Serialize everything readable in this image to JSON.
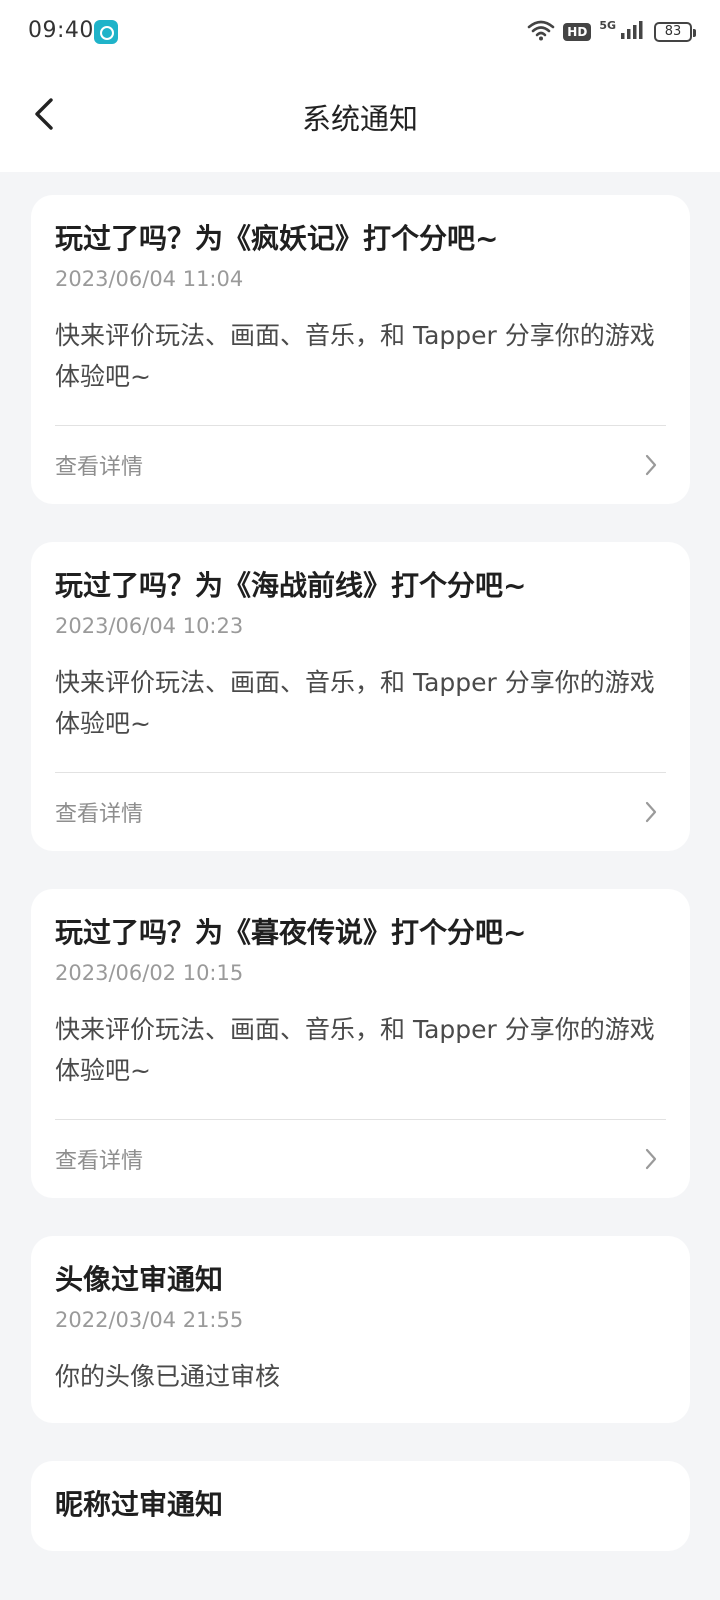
{
  "status_bar": {
    "time": "09:40",
    "hd": "HD",
    "network": "5G",
    "battery": "83"
  },
  "nav": {
    "title": "系统通知"
  },
  "notifications": [
    {
      "title": "玩过了吗？为《疯妖记》打个分吧~",
      "time": "2023/06/04 11:04",
      "body": "快来评价玩法、画面、音乐，和 Tapper 分享你的游戏体验吧~",
      "footer": "查看详情"
    },
    {
      "title": "玩过了吗？为《海战前线》打个分吧~",
      "time": "2023/06/04 10:23",
      "body": "快来评价玩法、画面、音乐，和 Tapper 分享你的游戏体验吧~",
      "footer": "查看详情"
    },
    {
      "title": "玩过了吗？为《暮夜传说》打个分吧~",
      "time": "2023/06/02 10:15",
      "body": "快来评价玩法、画面、音乐，和 Tapper 分享你的游戏体验吧~",
      "footer": "查看详情"
    },
    {
      "title": "头像过审通知",
      "time": "2022/03/04 21:55",
      "body": "你的头像已通过审核"
    },
    {
      "title": "昵称过审通知"
    }
  ],
  "icons": {
    "back": "chevron-left-icon",
    "detail": "chevron-right-icon",
    "wifi": "wifi-icon",
    "signal": "signal-bars-icon",
    "battery": "battery-icon"
  }
}
